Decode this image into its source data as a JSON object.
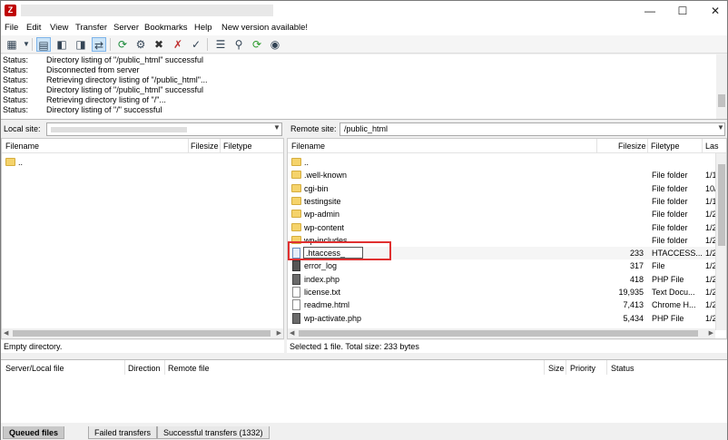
{
  "menu": {
    "items": [
      "File",
      "Edit",
      "View",
      "Transfer",
      "Server",
      "Bookmarks",
      "Help",
      "New version available!"
    ]
  },
  "log": {
    "label": "Status:",
    "messages": [
      "Directory listing of \"/public_html\" successful",
      "Disconnected from server",
      "Retrieving directory listing of \"/public_html\"...",
      "Directory listing of \"/public_html\" successful",
      "Retrieving directory listing of \"/\"...",
      "Directory listing of \"/\" successful"
    ]
  },
  "local": {
    "site_label": "Local site:",
    "site_value": "",
    "columns": [
      "Filename",
      "Filesize",
      "Filetype"
    ],
    "rows": [
      ".."
    ],
    "status": "Empty directory."
  },
  "remote": {
    "site_label": "Remote site:",
    "site_value": "/public_html",
    "columns": [
      "Filename",
      "Filesize",
      "Filetype",
      "Las"
    ],
    "rows": [
      {
        "name": "..",
        "size": "",
        "type": "",
        "date": "",
        "icon": "folder"
      },
      {
        "name": ".well-known",
        "size": "",
        "type": "File folder",
        "date": "1/1",
        "icon": "folder"
      },
      {
        "name": "cgi-bin",
        "size": "",
        "type": "File folder",
        "date": "10/",
        "icon": "folder"
      },
      {
        "name": "testingsite",
        "size": "",
        "type": "File folder",
        "date": "1/1",
        "icon": "folder"
      },
      {
        "name": "wp-admin",
        "size": "",
        "type": "File folder",
        "date": "1/2",
        "icon": "folder"
      },
      {
        "name": "wp-content",
        "size": "",
        "type": "File folder",
        "date": "1/2",
        "icon": "folder"
      },
      {
        "name": "wp-includes",
        "size": "",
        "type": "File folder",
        "date": "1/2",
        "icon": "folder"
      },
      {
        "name": ".htaccess_",
        "size": "233",
        "type": "HTACCESS...",
        "date": "1/2",
        "icon": "blue"
      },
      {
        "name": "error_log",
        "size": "317",
        "type": "File",
        "date": "1/2",
        "icon": "dark"
      },
      {
        "name": "index.php",
        "size": "418",
        "type": "PHP File",
        "date": "1/2",
        "icon": "php"
      },
      {
        "name": "license.txt",
        "size": "19,935",
        "type": "Text Docu...",
        "date": "1/2",
        "icon": "plain"
      },
      {
        "name": "readme.html",
        "size": "7,413",
        "type": "Chrome H...",
        "date": "1/2",
        "icon": "plain"
      },
      {
        "name": "wp-activate.php",
        "size": "5,434",
        "type": "PHP File",
        "date": "1/2",
        "icon": "php"
      }
    ],
    "status": "Selected 1 file. Total size: 233 bytes"
  },
  "queue": {
    "columns": [
      "Server/Local file",
      "Direction",
      "Remote file",
      "Size",
      "Priority",
      "Status"
    ]
  },
  "tabs": [
    "Queued files",
    "Failed transfers",
    "Successful transfers (1332)"
  ]
}
